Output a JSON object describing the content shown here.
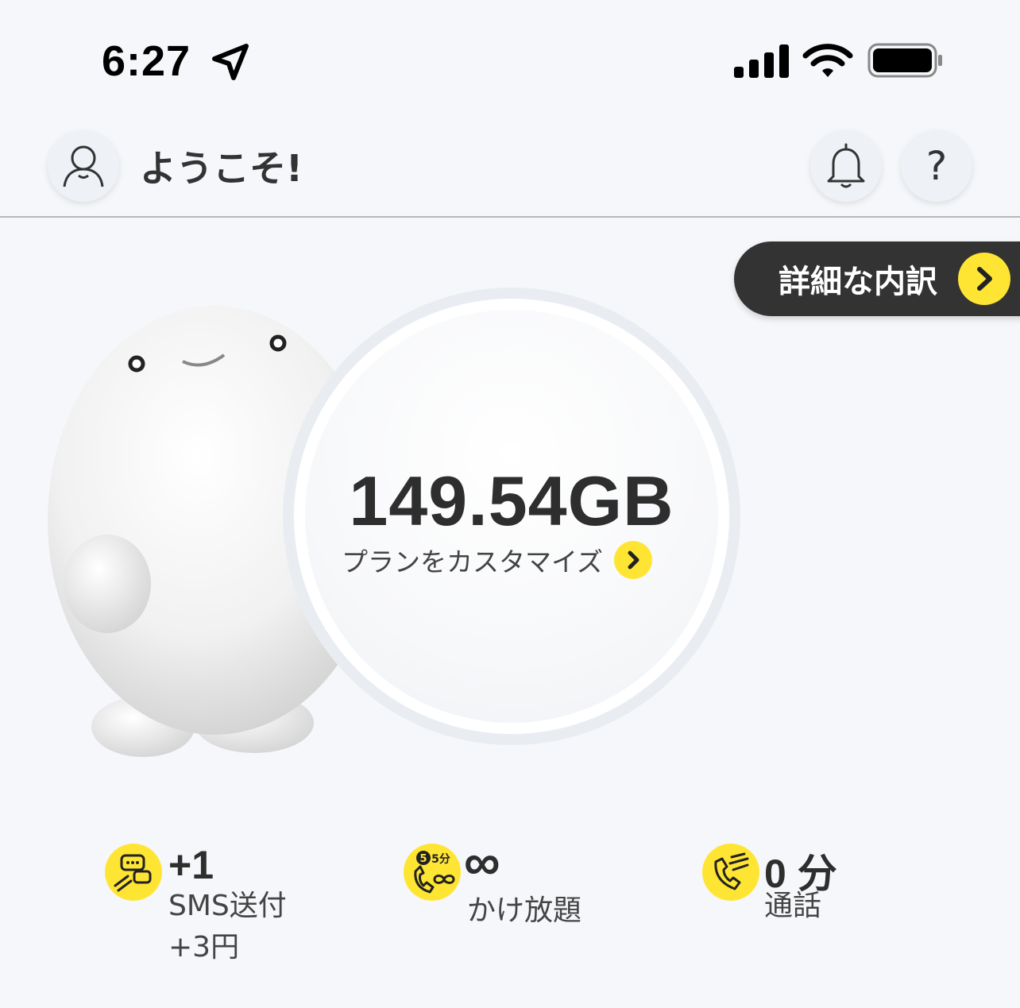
{
  "status_bar": {
    "time": "6:27",
    "icons": [
      "location-arrow-icon",
      "cellular-signal-icon",
      "wifi-icon",
      "battery-icon"
    ]
  },
  "header": {
    "welcome": "ようこそ!",
    "help_label": "?"
  },
  "details_button": {
    "label": "詳細な内訳"
  },
  "data_usage": {
    "amount": "149.54GB",
    "customize_label": "プランをカスタマイズ"
  },
  "stats": [
    {
      "icon": "sms-icon",
      "value": "+1",
      "label_line1": "SMS送付",
      "label_line2": "+3円"
    },
    {
      "icon": "five-min-call-icon",
      "icon_badge": "5分",
      "value": "∞",
      "label_line1": "かけ放題"
    },
    {
      "icon": "phone-call-icon",
      "value": "0 分",
      "label_line1": "通話"
    }
  ],
  "colors": {
    "accent": "#ffe533",
    "background": "#f5f7fa",
    "dark_pill": "#333333",
    "text": "#2e2e2e"
  }
}
